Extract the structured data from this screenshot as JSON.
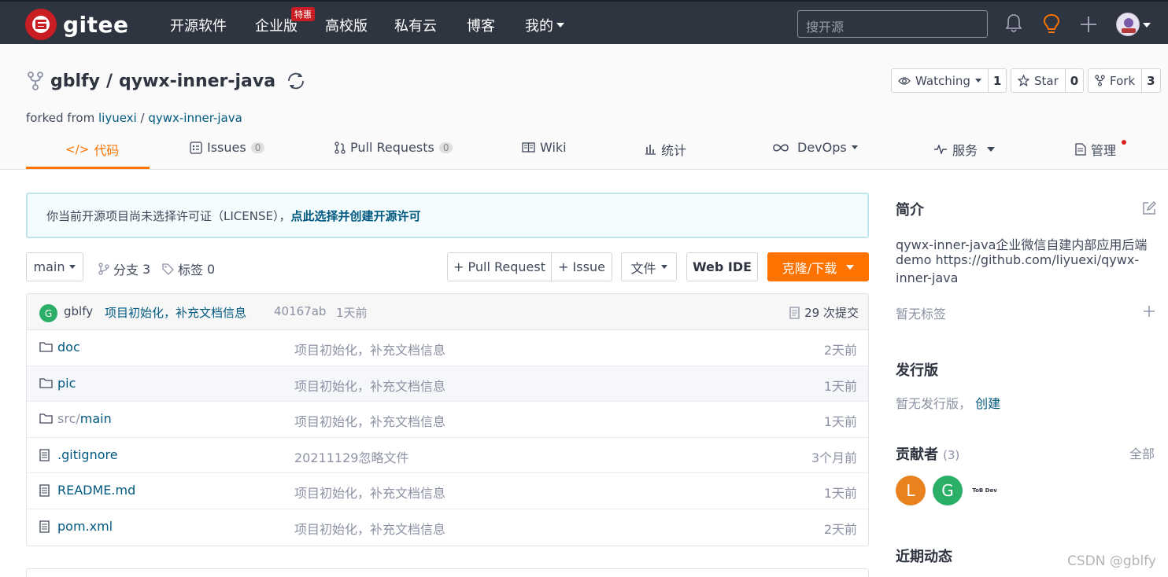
{
  "topnav": {
    "logo_text": "gitee",
    "items": [
      "开源软件",
      "企业版",
      "高校版",
      "私有云",
      "博客",
      "我的"
    ],
    "badge": "特惠",
    "search_placeholder": "搜开源"
  },
  "repo": {
    "owner": "gblfy",
    "separator": "/",
    "name": "qywx-inner-java",
    "forked_prefix": "forked from",
    "forked_owner": "liyuexi",
    "forked_separator": "/",
    "forked_name": "qywx-inner-java",
    "watch_label": "Watching",
    "watch_count": "1",
    "star_label": "Star",
    "star_count": "0",
    "fork_label": "Fork",
    "fork_count": "3"
  },
  "tabs": [
    {
      "label": "代码",
      "count": null
    },
    {
      "label": "Issues",
      "count": "0"
    },
    {
      "label": "Pull Requests",
      "count": "0"
    },
    {
      "label": "Wiki",
      "count": null
    },
    {
      "label": "统计",
      "count": null
    },
    {
      "label": "DevOps",
      "count": null
    },
    {
      "label": "服务",
      "count": null
    },
    {
      "label": "管理",
      "count": null
    }
  ],
  "license_notice": {
    "text": "你当前开源项目尚未选择许可证（LICENSE），",
    "link": "点此选择并创建开源许可"
  },
  "toolbar": {
    "branch": "main",
    "branches_label": "分支",
    "branches_count": "3",
    "tags_label": "标签",
    "tags_count": "0",
    "pull_request": "+ Pull Request",
    "issue": "+ Issue",
    "file": "文件",
    "web_ide": "Web IDE",
    "clone": "克隆/下载"
  },
  "commit": {
    "avatar": "G",
    "author": "gblfy",
    "message": "项目初始化，补充文档信息",
    "hash": "40167ab",
    "time": "1天前",
    "total": "29 次提交"
  },
  "files": [
    {
      "type": "folder",
      "name": "doc",
      "message": "项目初始化，补充文档信息",
      "time": "2天前"
    },
    {
      "type": "folder",
      "name": "pic",
      "message": "项目初始化，补充文档信息",
      "time": "1天前"
    },
    {
      "type": "folder",
      "name_prefix": "src/",
      "name": "main",
      "message": "项目初始化，补充文档信息",
      "time": "1天前"
    },
    {
      "type": "file",
      "name": ".gitignore",
      "message": "20211129忽略文件",
      "time": "3个月前"
    },
    {
      "type": "file",
      "name": "README.md",
      "message": "项目初始化，补充文档信息",
      "time": "1天前"
    },
    {
      "type": "file",
      "name": "pom.xml",
      "message": "项目初始化，补充文档信息",
      "time": "2天前"
    }
  ],
  "sidebar": {
    "intro_title": "简介",
    "intro_line1": "qywx-inner-java企业微信自建内部应用后端",
    "intro_line2": "demo https://github.com/liyuexi/qywx-",
    "intro_line3": "inner-java",
    "no_tags": "暂无标签",
    "release_title": "发行版",
    "no_release": "暂无发行版，",
    "create": "创建",
    "contributors_title": "贡献者",
    "contributors_count": "(3)",
    "all": "全部",
    "contributors": [
      {
        "initial": "L",
        "color": "#e8821e"
      },
      {
        "initial": "G",
        "color": "#2bae66"
      },
      {
        "initial": "ToB Dev",
        "color": "#ffffff"
      }
    ],
    "activity_title": "近期动态"
  },
  "watermark": "CSDN @gblfy",
  "colors": {
    "nav_bg": "#2e3440",
    "brand": "#c71d23",
    "accent": "#fe7300",
    "link": "#005980"
  }
}
